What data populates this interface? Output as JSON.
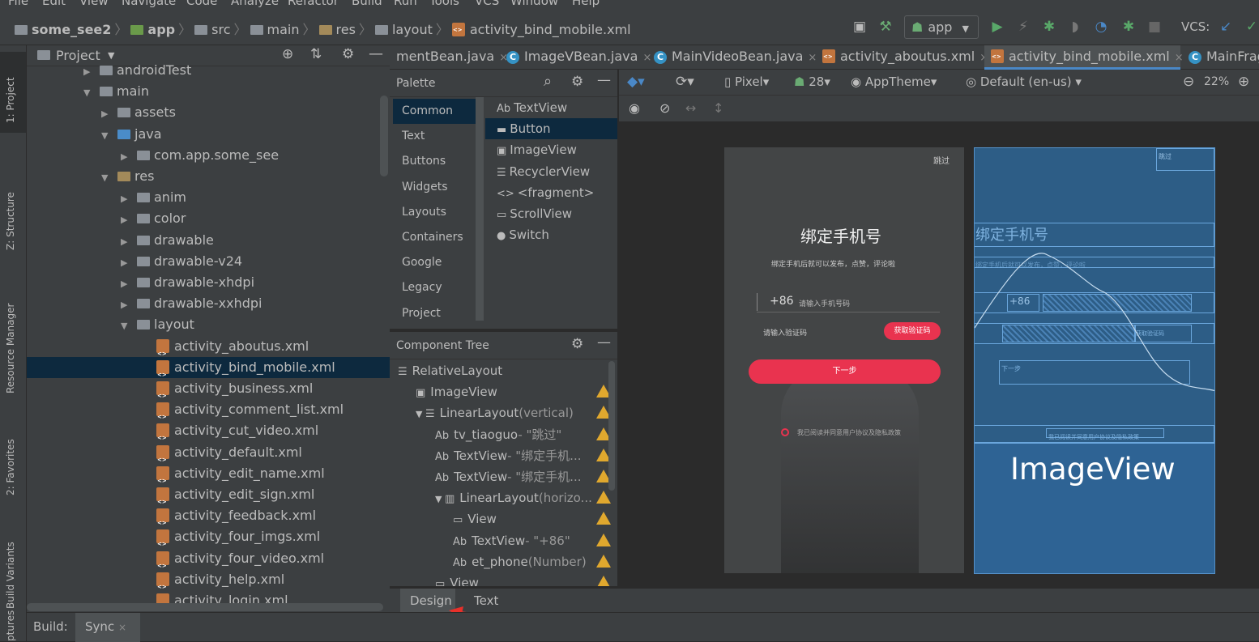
{
  "menu": [
    "File",
    "Edit",
    "View",
    "Navigate",
    "Code",
    "Analyze",
    "Refactor",
    "Build",
    "Run",
    "Tools",
    "VCS",
    "Window",
    "Help"
  ],
  "breadcrumb": {
    "project": "some_see2",
    "module": "app",
    "src": "src",
    "main": "main",
    "res": "res",
    "layout": "layout",
    "file": "activity_bind_mobile.xml"
  },
  "toolbar": {
    "run_config": "app",
    "vcs_label": "VCS:"
  },
  "side_tabs": {
    "project": "1: Project",
    "structure": "Z: Structure",
    "resource_manager": "Resource Manager",
    "favorites": "2: Favorites",
    "build_variants": "Build Variants",
    "captures": "ptures"
  },
  "project_panel": {
    "title": "Project",
    "rows": [
      {
        "label": "androidTest",
        "indent": 0,
        "type": "folder",
        "expanded": false
      },
      {
        "label": "main",
        "indent": 0,
        "type": "folder",
        "expanded": true
      },
      {
        "label": "assets",
        "indent": 1,
        "type": "folder",
        "expanded": false
      },
      {
        "label": "java",
        "indent": 1,
        "type": "folder-blue",
        "expanded": true
      },
      {
        "label": "com.app.some_see",
        "indent": 2,
        "type": "folder",
        "expanded": false
      },
      {
        "label": "res",
        "indent": 1,
        "type": "folder-res",
        "expanded": true
      },
      {
        "label": "anim",
        "indent": 2,
        "type": "folder",
        "expanded": false
      },
      {
        "label": "color",
        "indent": 2,
        "type": "folder",
        "expanded": false
      },
      {
        "label": "drawable",
        "indent": 2,
        "type": "folder",
        "expanded": false
      },
      {
        "label": "drawable-v24",
        "indent": 2,
        "type": "folder",
        "expanded": false
      },
      {
        "label": "drawable-xhdpi",
        "indent": 2,
        "type": "folder",
        "expanded": false
      },
      {
        "label": "drawable-xxhdpi",
        "indent": 2,
        "type": "folder",
        "expanded": false
      },
      {
        "label": "layout",
        "indent": 2,
        "type": "folder",
        "expanded": true
      },
      {
        "label": "activity_aboutus.xml",
        "indent": 3,
        "type": "xml"
      },
      {
        "label": "activity_bind_mobile.xml",
        "indent": 3,
        "type": "xml",
        "selected": true
      },
      {
        "label": "activity_business.xml",
        "indent": 3,
        "type": "xml"
      },
      {
        "label": "activity_comment_list.xml",
        "indent": 3,
        "type": "xml"
      },
      {
        "label": "activity_cut_video.xml",
        "indent": 3,
        "type": "xml"
      },
      {
        "label": "activity_default.xml",
        "indent": 3,
        "type": "xml"
      },
      {
        "label": "activity_edit_name.xml",
        "indent": 3,
        "type": "xml"
      },
      {
        "label": "activity_edit_sign.xml",
        "indent": 3,
        "type": "xml"
      },
      {
        "label": "activity_feedback.xml",
        "indent": 3,
        "type": "xml"
      },
      {
        "label": "activity_four_imgs.xml",
        "indent": 3,
        "type": "xml"
      },
      {
        "label": "activity_four_video.xml",
        "indent": 3,
        "type": "xml"
      },
      {
        "label": "activity_help.xml",
        "indent": 3,
        "type": "xml"
      },
      {
        "label": "activity_login.xml",
        "indent": 3,
        "type": "xml"
      }
    ]
  },
  "editor_tabs": [
    {
      "label": "mentBean.java",
      "icon": "class"
    },
    {
      "label": "ImageVBean.java",
      "icon": "class"
    },
    {
      "label": "MainVideoBean.java",
      "icon": "class"
    },
    {
      "label": "activity_aboutus.xml",
      "icon": "xml"
    },
    {
      "label": "activity_bind_mobile.xml",
      "icon": "xml",
      "active": true
    },
    {
      "label": "MainFrag",
      "icon": "class"
    }
  ],
  "palette": {
    "title": "Palette",
    "categories": [
      "Common",
      "Text",
      "Buttons",
      "Widgets",
      "Layouts",
      "Containers",
      "Google",
      "Legacy",
      "Project"
    ],
    "items": [
      {
        "prefix": "Ab",
        "label": "TextView"
      },
      {
        "prefix": "▬",
        "label": "Button",
        "selected": true
      },
      {
        "prefix": "▣",
        "label": "ImageView"
      },
      {
        "prefix": "☰",
        "label": "RecyclerView"
      },
      {
        "prefix": "<>",
        "label": "<fragment>"
      },
      {
        "prefix": "▭",
        "label": "ScrollView"
      },
      {
        "prefix": "●",
        "label": "Switch"
      }
    ]
  },
  "component_tree": {
    "title": "Component Tree",
    "rows": [
      {
        "label": "RelativeLayout",
        "suffix": "",
        "indent": 0,
        "icon": "layout",
        "warn": false
      },
      {
        "label": "ImageView",
        "suffix": "",
        "indent": 1,
        "icon": "image",
        "warn": true
      },
      {
        "label": "LinearLayout",
        "suffix": "(vertical)",
        "indent": 1,
        "icon": "layout",
        "warn": true,
        "expand": true
      },
      {
        "label": "tv_tiaoguo",
        "suffix": "- \"跳过\"",
        "indent": 2,
        "icon": "Ab",
        "warn": true
      },
      {
        "label": "TextView",
        "suffix": "- \"绑定手机...",
        "indent": 2,
        "icon": "Ab",
        "warn": true
      },
      {
        "label": "TextView",
        "suffix": "- \"绑定手机...",
        "indent": 2,
        "icon": "Ab",
        "warn": true
      },
      {
        "label": "LinearLayout",
        "suffix": "(horizo...",
        "indent": 2,
        "icon": "hlayout",
        "warn": true,
        "expand": true
      },
      {
        "label": "View",
        "suffix": "",
        "indent": 3,
        "icon": "view",
        "warn": true
      },
      {
        "label": "TextView",
        "suffix": "- \"+86\"",
        "indent": 3,
        "icon": "Ab",
        "warn": true
      },
      {
        "label": "et_phone",
        "suffix": "(Number)",
        "indent": 3,
        "icon": "Ab_",
        "warn": true
      },
      {
        "label": "View",
        "suffix": "",
        "indent": 2,
        "icon": "view",
        "warn": true
      }
    ]
  },
  "editor_toolbar": {
    "device": "Pixel",
    "api": "28",
    "theme": "AppTheme",
    "locale": "Default (en-us)",
    "zoom": "22%"
  },
  "preview": {
    "skip": "跳过",
    "title": "绑定手机号",
    "subtitle": "绑定手机后就可以发布，点赞，评论啦",
    "code": "+86",
    "phone_placeholder": "请输入手机号码",
    "verify_placeholder": "请输入验证码",
    "get_code": "获取验证码",
    "next": "下一步",
    "agreement": "我已阅读并同意用户协议及隐私政策"
  },
  "blueprint": {
    "title": "绑定手机号",
    "subtitle": "绑定手机后就可以发布，点赞，评论啦",
    "code": "+86",
    "get_code": "获取验证码",
    "next": "下一步",
    "skip": "跳过",
    "agreement": "我已阅读并同意用户协议及隐私政策",
    "image_label": "ImageView"
  },
  "design_tabs": {
    "design": "Design",
    "text": "Text"
  },
  "status": {
    "build": "Build:",
    "sync": "Sync"
  },
  "colors": {
    "accent": "#4a88c7",
    "selection": "#0d293e",
    "warning": "#e0a82e",
    "button": "#e9334f"
  }
}
